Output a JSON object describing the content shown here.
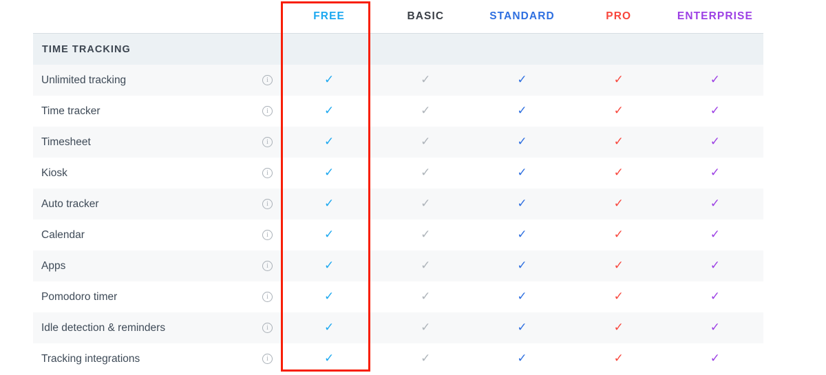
{
  "plans": [
    {
      "label": "FREE",
      "color": "#1CA8F0",
      "check_color": "#1CA8F0"
    },
    {
      "label": "BASIC",
      "color": "#3A3F46",
      "check_color": "#AEB4BA"
    },
    {
      "label": "STANDARD",
      "color": "#2E6FE0",
      "check_color": "#2E6FE0"
    },
    {
      "label": "PRO",
      "color": "#F8463C",
      "check_color": "#F8463C"
    },
    {
      "label": "ENTERPRISE",
      "color": "#9C3FE4",
      "check_color": "#9C3FE4"
    }
  ],
  "section": {
    "title": "TIME TRACKING"
  },
  "check_glyph": "✓",
  "info_glyph": "i",
  "features": [
    {
      "label": "Unlimited tracking",
      "values": [
        true,
        true,
        true,
        true,
        true
      ]
    },
    {
      "label": "Time tracker",
      "values": [
        true,
        true,
        true,
        true,
        true
      ]
    },
    {
      "label": "Timesheet",
      "values": [
        true,
        true,
        true,
        true,
        true
      ]
    },
    {
      "label": "Kiosk",
      "values": [
        true,
        true,
        true,
        true,
        true
      ]
    },
    {
      "label": "Auto tracker",
      "values": [
        true,
        true,
        true,
        true,
        true
      ]
    },
    {
      "label": "Calendar",
      "values": [
        true,
        true,
        true,
        true,
        true
      ]
    },
    {
      "label": "Apps",
      "values": [
        true,
        true,
        true,
        true,
        true
      ]
    },
    {
      "label": "Pomodoro timer",
      "values": [
        true,
        true,
        true,
        true,
        true
      ]
    },
    {
      "label": "Idle detection & reminders",
      "values": [
        true,
        true,
        true,
        true,
        true
      ]
    },
    {
      "label": "Tracking integrations",
      "values": [
        true,
        true,
        true,
        true,
        true
      ]
    }
  ],
  "annotation": {
    "color": "#F81E05",
    "target_plan": "FREE"
  }
}
